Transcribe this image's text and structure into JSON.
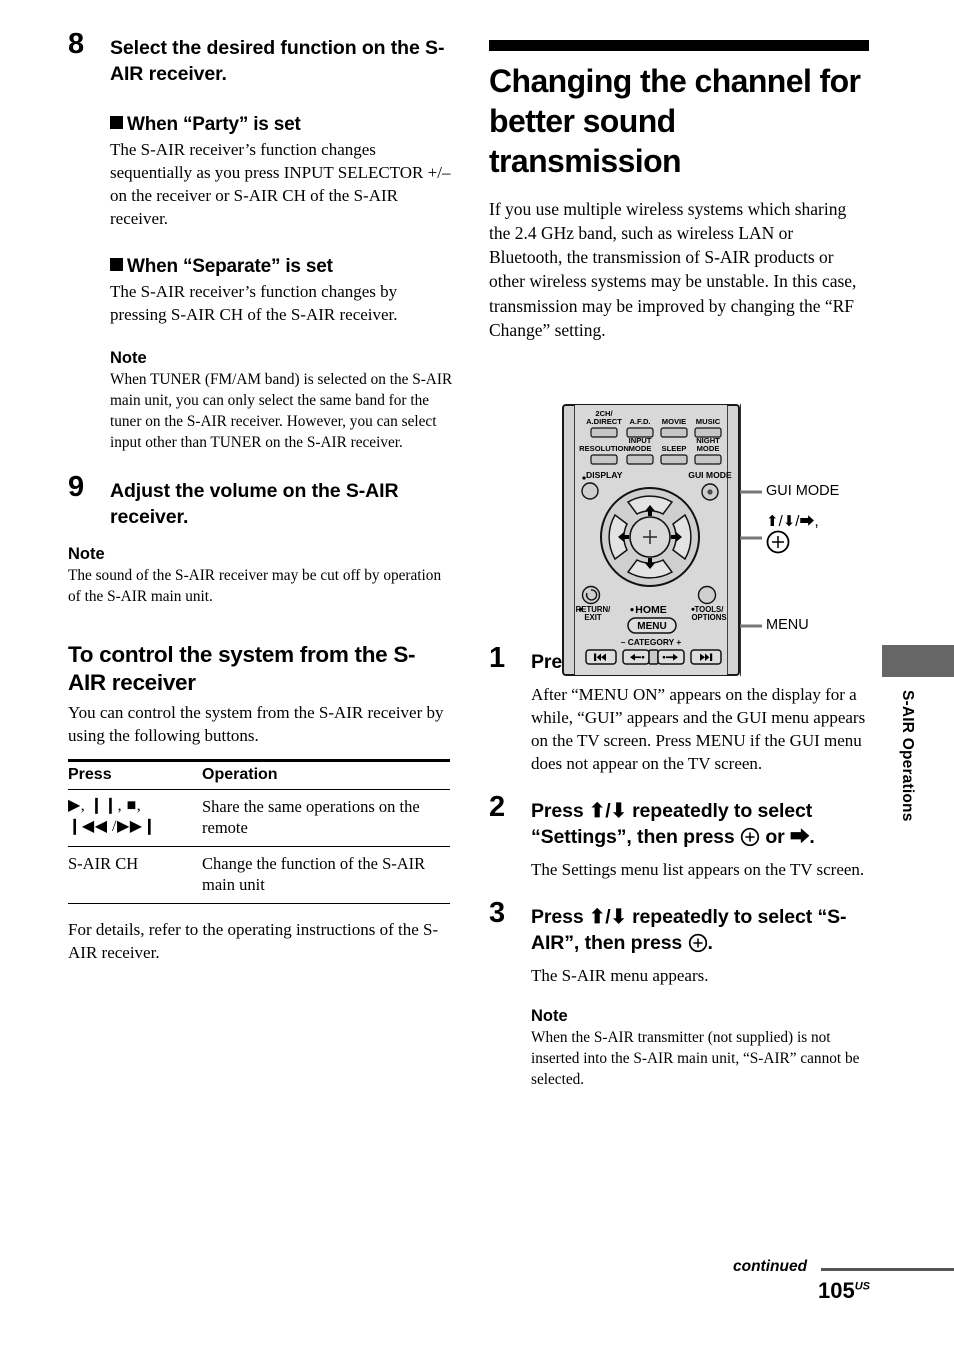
{
  "page": {
    "number": "105",
    "number_suffix": "US",
    "continued_label": "continued",
    "side_tab_label": "S-AIR Operations",
    "side_tab_color": "#666666"
  },
  "left_column": {
    "step8": {
      "num": "8",
      "title": "Select the desired function on the S-AIR receiver.",
      "sections": [
        {
          "heading": "When “Party” is set",
          "body": "The S-AIR receiver’s function changes sequentially as you press INPUT SELECTOR +/– on the receiver or S-AIR CH of the S-AIR receiver."
        },
        {
          "heading": "When “Separate” is set",
          "body": "The S-AIR receiver’s function changes by pressing S-AIR CH of the S-AIR receiver."
        }
      ],
      "note": {
        "heading": "Note",
        "body": "When TUNER (FM/AM band) is selected on the S-AIR main unit, you can only select the same band for the tuner on the S-AIR receiver. However, you can select input other than TUNER on the S-AIR receiver."
      }
    },
    "step9": {
      "num": "9",
      "title": "Adjust the volume on the S-AIR receiver."
    },
    "note9": {
      "heading": "Note",
      "body": "The sound of the S-AIR receiver may be cut off by operation of the S-AIR main unit."
    },
    "control_section": {
      "heading": "To control the system from the S-AIR receiver",
      "intro": "You can control the system from the S-AIR receiver by using the following buttons.",
      "table": {
        "headers": [
          "Press",
          "Operation"
        ],
        "rows": [
          {
            "press_line1": "▶, ❙❙, ■,",
            "press_line2": "❙◀◀ /▶▶❙",
            "operation": "Share the same operations on the remote"
          },
          {
            "press_line1": "S-AIR CH",
            "press_line2": "",
            "operation": "Change the function of the S-AIR main unit"
          }
        ]
      },
      "outro": "For details, refer to the operating instructions of the S-AIR receiver."
    }
  },
  "right_column": {
    "heading": "Changing the channel for better sound transmission",
    "intro": "If you use multiple wireless systems which sharing the 2.4 GHz band, such as wireless LAN or Bluetooth, the transmission of S-AIR products or other wireless systems may be unstable. In this case, transmission may be improved by changing the “RF Change” setting.",
    "steps": [
      {
        "num": "1",
        "title": "Press GUI MODE.",
        "body": "After “MENU ON” appears on the display for a while, “GUI” appears and the GUI menu appears on the TV screen. Press MENU if the GUI menu does not appear on the TV screen."
      },
      {
        "num": "2",
        "title_part1": "Press ",
        "title_arrows": "⬆/⬇",
        "title_part2": " repeatedly to select “Settings”, then press ",
        "title_enter": "enter-button-icon",
        "title_part3": " or ",
        "title_right_arrow": "⮕",
        "title_part4": ".",
        "body": "The Settings menu list appears on the TV screen."
      },
      {
        "num": "3",
        "title_part1": "Press ",
        "title_arrows": "⬆/⬇",
        "title_part2": " repeatedly to select “S-AIR”, then press ",
        "title_enter": "enter-button-icon",
        "title_part3": ".",
        "body": "The S-AIR menu appears."
      }
    ],
    "note": {
      "heading": "Note",
      "body": "When the S-AIR transmitter (not supplied) is not inserted into the S-AIR main unit, “S-AIR” cannot be selected."
    }
  },
  "remote": {
    "buttons_row1": [
      "2CH/\nA.DIRECT",
      "A.F.D.",
      "MOVIE",
      "MUSIC"
    ],
    "buttons_row2": [
      "RESOLUTION",
      "INPUT\nMODE",
      "SLEEP",
      "NIGHT\nMODE"
    ],
    "display_label": "DISPLAY",
    "gui_mode_label": "GUI MODE",
    "return_label": "RETURN/\nEXIT",
    "home_label": "HOME",
    "menu_label": "MENU",
    "tools_label": "TOOLS/\nOPTIONS",
    "category_label": "CATEGORY",
    "category_minus": "–",
    "category_plus": "+",
    "skip_prev": "❙◀◀",
    "skip_next": "▶▶❙",
    "callouts": [
      {
        "label": "GUI MODE"
      },
      {
        "label": "⬆/⬇/⮕,"
      },
      {
        "label": "MENU"
      }
    ]
  }
}
